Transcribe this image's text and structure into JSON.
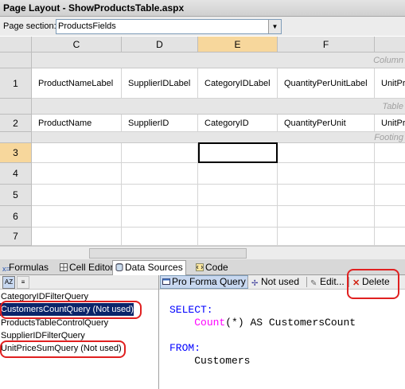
{
  "window": {
    "title": "Page Layout - ShowProductsTable.aspx"
  },
  "section": {
    "label": "Page section:",
    "value": "ProductsFields"
  },
  "grid": {
    "columns": [
      "C",
      "D",
      "E",
      "F"
    ],
    "band_labels": [
      "Column",
      "Table",
      "Footing"
    ],
    "rows": [
      {
        "num": "1",
        "cells": [
          "ProductNameLabel",
          "SupplierIDLabel",
          "CategoryIDLabel",
          "QuantityPerUnitLabel",
          "UnitPr"
        ]
      },
      {
        "num": "2",
        "cells": [
          "ProductName",
          "SupplierID",
          "CategoryID",
          "QuantityPerUnit",
          "UnitPr"
        ]
      },
      {
        "num": "3"
      },
      {
        "num": "4"
      },
      {
        "num": "5"
      },
      {
        "num": "6"
      },
      {
        "num": "7"
      }
    ]
  },
  "tabs": [
    "Formulas",
    "Cell Editor",
    "Data Sources",
    "Code"
  ],
  "queries": [
    "CategoryIDFilterQuery",
    "CustomersCountQuery (Not used)",
    "ProductsTableControlQuery",
    "SupplierIDFilterQuery",
    "UnitPriceSumQuery (Not used)"
  ],
  "toolbar": {
    "pro_forma": "Pro Forma Query",
    "not_used": "Not used",
    "edit": "Edit...",
    "delete": "Delete"
  },
  "sql": {
    "select_kw": "SELECT:",
    "count_fn": "Count",
    "expr_rest": "(*) AS CustomersCount",
    "from_kw": "FROM:",
    "table": "Customers"
  },
  "colors": {
    "selection": "#0a246a",
    "highlight_box": "#e02020",
    "keyword": "#0000ff",
    "function": "#ff00ff"
  }
}
